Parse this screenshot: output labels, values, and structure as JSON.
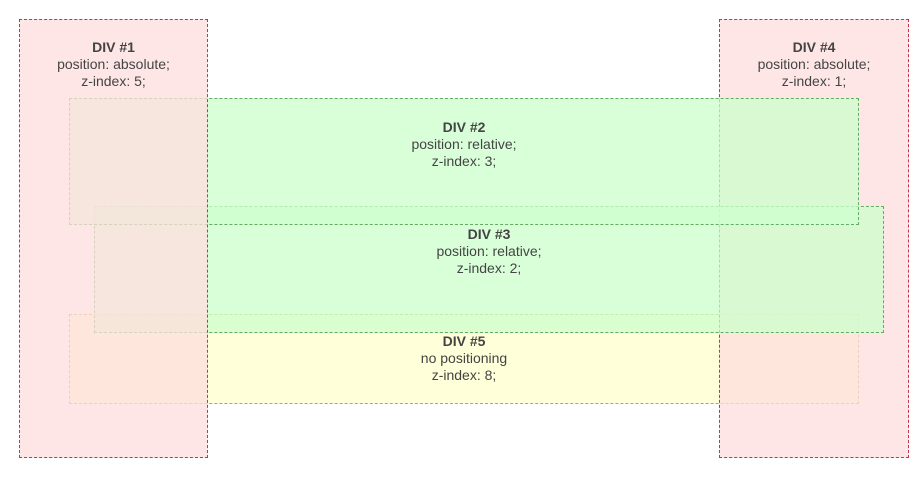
{
  "divs": {
    "div1": {
      "title": "DIV #1",
      "position": "position: absolute;",
      "zindex": "z-index: 5;",
      "color": "#ffdddd",
      "border_color": "#c8324b"
    },
    "div2": {
      "title": "DIV #2",
      "position": "position: relative;",
      "zindex": "z-index: 3;",
      "color": "#ccffcc",
      "border_color": "#66aa66"
    },
    "div3": {
      "title": "DIV #3",
      "position": "position: relative;",
      "zindex": "z-index: 2;",
      "color": "#ccffcc",
      "border_color": "#66aa66"
    },
    "div4": {
      "title": "DIV #4",
      "position": "position: absolute;",
      "zindex": "z-index: 1;",
      "color": "#ffdddd",
      "border_color": "#c8324b"
    },
    "div5": {
      "title": "DIV #5",
      "position": "no positioning",
      "zindex": "z-index: 8;",
      "color": "#ffffcc",
      "border_color": "#aaaa66"
    }
  }
}
